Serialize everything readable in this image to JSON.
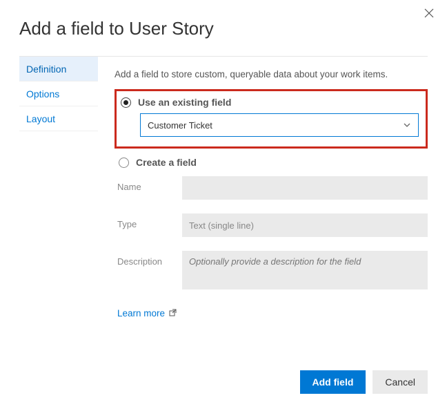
{
  "dialog": {
    "title": "Add a field to User Story"
  },
  "tabs": {
    "items": [
      {
        "label": "Definition"
      },
      {
        "label": "Options"
      },
      {
        "label": "Layout"
      }
    ]
  },
  "content": {
    "intro": "Add a field to store custom, queryable data about your work items.",
    "existing": {
      "label": "Use an existing field",
      "selected_value": "Customer Ticket"
    },
    "create": {
      "label": "Create a field",
      "name_label": "Name",
      "name_value": "",
      "type_label": "Type",
      "type_value": "Text (single line)",
      "description_label": "Description",
      "description_placeholder": "Optionally provide a description for the field"
    },
    "learn_more": "Learn more"
  },
  "footer": {
    "primary": "Add field",
    "secondary": "Cancel"
  }
}
